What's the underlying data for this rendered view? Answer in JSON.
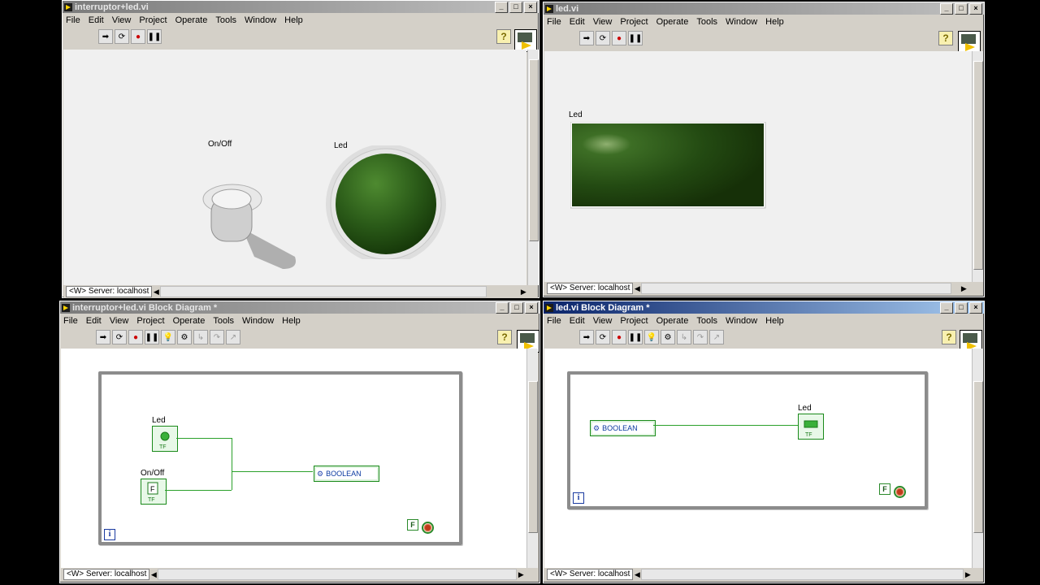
{
  "menu": [
    "File",
    "Edit",
    "View",
    "Project",
    "Operate",
    "Tools",
    "Window",
    "Help"
  ],
  "server": "<W> Server: localhost",
  "windows": {
    "fp1": {
      "title": "interruptor+led.vi",
      "controls": {
        "switch_label": "On/Off",
        "led_label": "Led"
      }
    },
    "fp2": {
      "title": "led.vi",
      "controls": {
        "led_label": "Led"
      }
    },
    "bd1": {
      "title": "interruptor+led.vi Block Diagram *",
      "nodes": {
        "led": "Led",
        "onoff": "On/Off",
        "boolean": "BOOLEAN",
        "tf": "TF",
        "false": "F",
        "iter": "i"
      }
    },
    "bd2": {
      "title": "led.vi Block Diagram *",
      "nodes": {
        "led": "Led",
        "boolean": "BOOLEAN",
        "tf": "TF",
        "false": "F",
        "iter": "i"
      }
    }
  },
  "colors": {
    "led_green": "#2e5a1c",
    "wire_green": "#2aa02a",
    "titlebar_active": "#0a246a"
  }
}
